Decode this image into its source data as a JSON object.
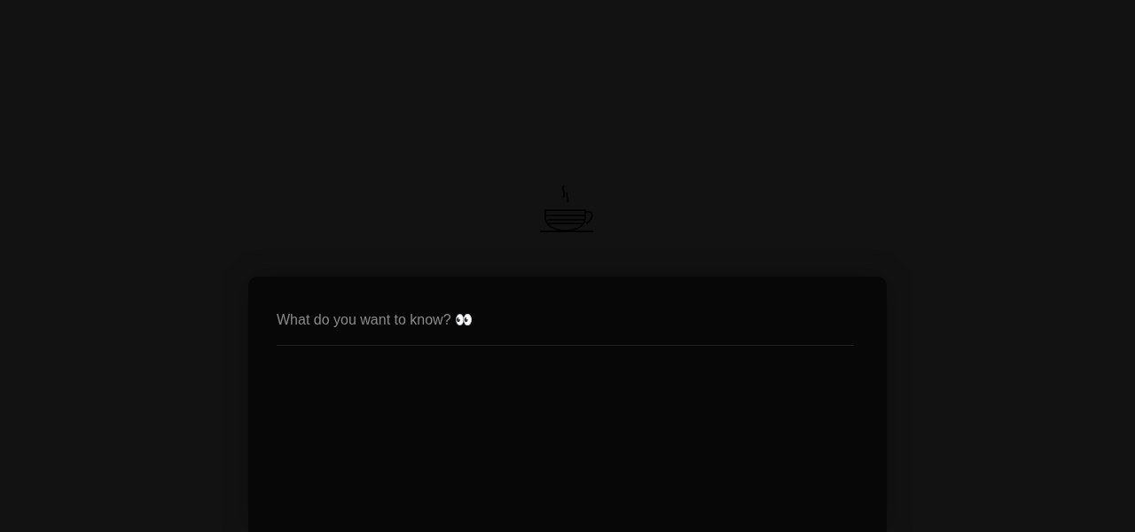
{
  "search": {
    "placeholder": "What do you want to know? 👀"
  }
}
